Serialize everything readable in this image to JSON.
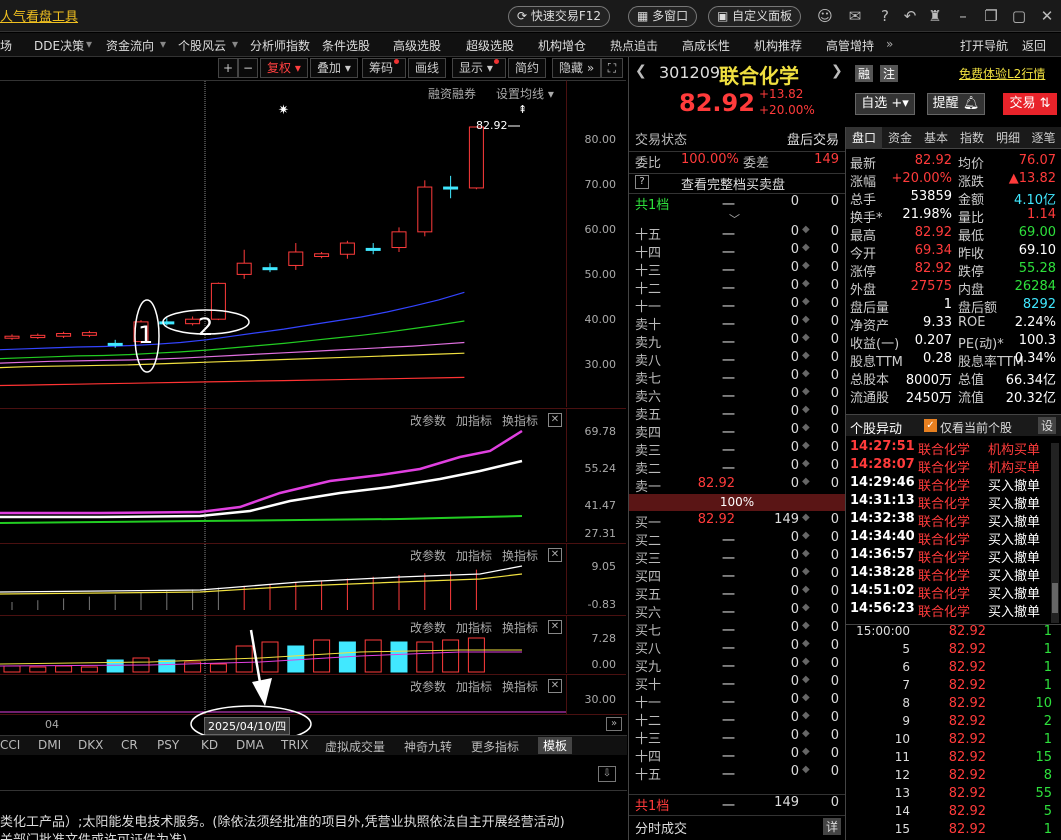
{
  "titlebar": {
    "app_title": "人气看盘工具",
    "quick_trade": "快速交易F12",
    "multi_window": "多窗口",
    "custom_panel": "自定义面板"
  },
  "menu": [
    "场",
    "DDE决策",
    "资金流向",
    "个股风云",
    "分析师指数",
    "条件选股",
    "高级选股",
    "超级选股",
    "机构增仓",
    "热点追击",
    "高成长性",
    "机构推荐",
    "高管增持",
    "打开导航",
    "返回"
  ],
  "chart_toolbar": {
    "fuquan": "复权",
    "overlay": "叠加",
    "chips": "筹码",
    "draw": "画线",
    "display": "显示",
    "simple": "简约",
    "hide": "隐藏"
  },
  "main_panel": {
    "margin_label": "融资融券",
    "ma_settings": "设置均线",
    "last_price_tag": "82.92",
    "y_ticks": [
      "80.00",
      "70.00",
      "60.00",
      "50.00",
      "40.00",
      "30.00"
    ],
    "annotation_1": "1",
    "annotation_2": "2"
  },
  "sub_panels": [
    {
      "btns": [
        "改参数",
        "加指标",
        "换指标"
      ],
      "ticks": [
        "69.78",
        "55.24",
        "41.47",
        "27.31"
      ]
    },
    {
      "btns": [
        "改参数",
        "加指标",
        "换指标"
      ],
      "ticks": [
        "9.05",
        "-0.83"
      ]
    },
    {
      "btns": [
        "改参数",
        "加指标",
        "换指标"
      ],
      "ticks": [
        "7.28",
        "0.00"
      ]
    },
    {
      "btns": [
        "改参数",
        "加指标",
        "换指标"
      ],
      "ticks": [
        "30.00"
      ]
    }
  ],
  "date_axis": {
    "month_label": "04",
    "cursor_date": "2025/04/10/四"
  },
  "indicator_tabs": [
    "CCI",
    "DMI",
    "DKX",
    "CR",
    "PSY",
    "KD",
    "DMA",
    "TRIX",
    "虚拟成交量",
    "神奇九转",
    "更多指标",
    "模板"
  ],
  "info_text": {
    "line1": "类化工产品）;太阳能发电技术服务。(除依法须经批准的项目外,凭营业执照依法自主开展经营活动)",
    "line2": "关部门批准文件或许可证件为准)"
  },
  "stock": {
    "code": "301209",
    "name": "联合化学",
    "price": "82.92",
    "change": "+13.82",
    "change_pct": "+20.00%",
    "rong": "融",
    "zhu": "注",
    "l2_link": "免费体验L2行情",
    "watch_btn": "自选",
    "alert_btn": "提醒",
    "trade_btn": "交易"
  },
  "orderbook": {
    "status_label": "交易状态",
    "status_value": "盘后交易",
    "ratio_label": "委比",
    "ratio_value": "100.00%",
    "diff_label": "委差",
    "diff_value": "149",
    "full_book": "查看完整档买卖盘",
    "total_top": {
      "label": "共1档",
      "price": "一",
      "vol": "0",
      "w": "0"
    },
    "asks": [
      {
        "label": "十五",
        "price": "一",
        "vol": "0",
        "w": "0"
      },
      {
        "label": "十四",
        "price": "一",
        "vol": "0",
        "w": "0"
      },
      {
        "label": "十三",
        "price": "一",
        "vol": "0",
        "w": "0"
      },
      {
        "label": "十二",
        "price": "一",
        "vol": "0",
        "w": "0"
      },
      {
        "label": "十一",
        "price": "一",
        "vol": "0",
        "w": "0"
      },
      {
        "label": "卖十",
        "price": "一",
        "vol": "0",
        "w": "0"
      },
      {
        "label": "卖九",
        "price": "一",
        "vol": "0",
        "w": "0"
      },
      {
        "label": "卖八",
        "price": "一",
        "vol": "0",
        "w": "0"
      },
      {
        "label": "卖七",
        "price": "一",
        "vol": "0",
        "w": "0"
      },
      {
        "label": "卖六",
        "price": "一",
        "vol": "0",
        "w": "0"
      },
      {
        "label": "卖五",
        "price": "一",
        "vol": "0",
        "w": "0"
      },
      {
        "label": "卖四",
        "price": "一",
        "vol": "0",
        "w": "0"
      },
      {
        "label": "卖三",
        "price": "一",
        "vol": "0",
        "w": "0"
      },
      {
        "label": "卖二",
        "price": "一",
        "vol": "0",
        "w": "0"
      },
      {
        "label": "卖一",
        "price": "82.92",
        "vol": "0",
        "w": "0"
      }
    ],
    "mid_pct": "100%",
    "bids": [
      {
        "label": "买一",
        "price": "82.92",
        "vol": "149",
        "w": "0"
      },
      {
        "label": "买二",
        "price": "一",
        "vol": "0",
        "w": "0"
      },
      {
        "label": "买三",
        "price": "一",
        "vol": "0",
        "w": "0"
      },
      {
        "label": "买四",
        "price": "一",
        "vol": "0",
        "w": "0"
      },
      {
        "label": "买五",
        "price": "一",
        "vol": "0",
        "w": "0"
      },
      {
        "label": "买六",
        "price": "一",
        "vol": "0",
        "w": "0"
      },
      {
        "label": "买七",
        "price": "一",
        "vol": "0",
        "w": "0"
      },
      {
        "label": "买八",
        "price": "一",
        "vol": "0",
        "w": "0"
      },
      {
        "label": "买九",
        "price": "一",
        "vol": "0",
        "w": "0"
      },
      {
        "label": "买十",
        "price": "一",
        "vol": "0",
        "w": "0"
      },
      {
        "label": "十一",
        "price": "一",
        "vol": "0",
        "w": "0"
      },
      {
        "label": "十二",
        "price": "一",
        "vol": "0",
        "w": "0"
      },
      {
        "label": "十三",
        "price": "一",
        "vol": "0",
        "w": "0"
      },
      {
        "label": "十四",
        "price": "一",
        "vol": "0",
        "w": "0"
      },
      {
        "label": "十五",
        "price": "一",
        "vol": "0",
        "w": "0"
      }
    ],
    "total_bottom": {
      "label": "共1档",
      "price": "一",
      "vol": "149",
      "w": "0"
    },
    "tick_title": "分时成交",
    "tick_btn": "详"
  },
  "quote": {
    "tabs": [
      "盘口",
      "资金",
      "基本",
      "指数",
      "明细",
      "逐笔"
    ],
    "rows": [
      {
        "l1": "最新",
        "v1": "82.92",
        "c1": "red",
        "l2": "均价",
        "v2": "76.07",
        "c2": "red"
      },
      {
        "l1": "涨幅",
        "v1": "+20.00%",
        "c1": "red",
        "l2": "涨跌",
        "v2": "▲13.82",
        "c2": "red"
      },
      {
        "l1": "总手",
        "v1": "53859",
        "c1": "white",
        "l2": "金额",
        "v2": "4.10亿",
        "c2": "cyan"
      },
      {
        "l1": "换手*",
        "v1": "21.98%",
        "c1": "white",
        "l2": "量比",
        "v2": "1.14",
        "c2": "red"
      },
      {
        "l1": "最高",
        "v1": "82.92",
        "c1": "red",
        "l2": "最低",
        "v2": "69.00",
        "c2": "green"
      },
      {
        "l1": "今开",
        "v1": "69.34",
        "c1": "red",
        "l2": "昨收",
        "v2": "69.10",
        "c2": "white"
      },
      {
        "l1": "涨停",
        "v1": "82.92",
        "c1": "red",
        "l2": "跌停",
        "v2": "55.28",
        "c2": "green"
      },
      {
        "l1": "外盘",
        "v1": "27575",
        "c1": "red",
        "l2": "内盘",
        "v2": "26284",
        "c2": "green"
      },
      {
        "l1": "盘后量",
        "v1": "1",
        "c1": "white",
        "l2": "盘后额",
        "v2": "8292",
        "c2": "cyan"
      },
      {
        "l1": "净资产",
        "v1": "9.33",
        "c1": "white",
        "l2": "ROE",
        "v2": "2.24%",
        "c2": "white"
      },
      {
        "l1": "收益(一)",
        "v1": "0.207",
        "c1": "white",
        "l2": "PE(动)*",
        "v2": "100.3",
        "c2": "white"
      },
      {
        "l1": "股息TTM",
        "v1": "0.28",
        "c1": "white",
        "l2": "股息率TTM",
        "v2": "0.34%",
        "c2": "white"
      },
      {
        "l1": "总股本",
        "v1": "8000万",
        "c1": "white",
        "l2": "总值",
        "v2": "66.34亿",
        "c2": "white"
      },
      {
        "l1": "流通股",
        "v1": "2450万",
        "c1": "white",
        "l2": "流值",
        "v2": "20.32亿",
        "c2": "white"
      }
    ],
    "movement_title": "个股异动",
    "movement_check": "仅看当前个股",
    "movement_set": "设",
    "movements": [
      {
        "t": "14:27:51",
        "s": "联合化学",
        "a": "机构买单",
        "c": "red"
      },
      {
        "t": "14:28:07",
        "s": "联合化学",
        "a": "机构买单",
        "c": "red"
      },
      {
        "t": "14:29:46",
        "s": "联合化学",
        "a": "买入撤单",
        "c": "white"
      },
      {
        "t": "14:31:13",
        "s": "联合化学",
        "a": "买入撤单",
        "c": "white"
      },
      {
        "t": "14:32:38",
        "s": "联合化学",
        "a": "买入撤单",
        "c": "white"
      },
      {
        "t": "14:34:40",
        "s": "联合化学",
        "a": "买入撤单",
        "c": "white"
      },
      {
        "t": "14:36:57",
        "s": "联合化学",
        "a": "买入撤单",
        "c": "white"
      },
      {
        "t": "14:38:28",
        "s": "联合化学",
        "a": "买入撤单",
        "c": "white"
      },
      {
        "t": "14:51:02",
        "s": "联合化学",
        "a": "买入撤单",
        "c": "white"
      },
      {
        "t": "14:56:23",
        "s": "联合化学",
        "a": "买入撤单",
        "c": "white"
      }
    ],
    "ticks": [
      {
        "t": "15:00:00",
        "p": "82.92",
        "v": "1"
      },
      {
        "t": "5",
        "p": "82.92",
        "v": "1"
      },
      {
        "t": "6",
        "p": "82.92",
        "v": "1"
      },
      {
        "t": "7",
        "p": "82.92",
        "v": "1"
      },
      {
        "t": "8",
        "p": "82.92",
        "v": "10"
      },
      {
        "t": "9",
        "p": "82.92",
        "v": "2"
      },
      {
        "t": "10",
        "p": "82.92",
        "v": "1"
      },
      {
        "t": "11",
        "p": "82.92",
        "v": "15"
      },
      {
        "t": "12",
        "p": "82.92",
        "v": "8"
      },
      {
        "t": "13",
        "p": "82.92",
        "v": "55"
      },
      {
        "t": "14",
        "p": "82.92",
        "v": "5"
      },
      {
        "t": "15",
        "p": "82.92",
        "v": "1"
      }
    ]
  },
  "chart_data": {
    "type": "candlestick",
    "ylim": [
      20,
      90
    ],
    "candles": [
      {
        "o": 35.8,
        "c": 36.2,
        "h": 36.6,
        "l": 35.4
      },
      {
        "o": 35.9,
        "c": 36.4,
        "h": 36.8,
        "l": 35.6
      },
      {
        "o": 36.2,
        "c": 36.8,
        "h": 37.2,
        "l": 35.8
      },
      {
        "o": 36.4,
        "c": 37.0,
        "h": 37.4,
        "l": 36.0
      },
      {
        "o": 34.6,
        "c": 34.6,
        "h": 35.4,
        "l": 33.6
      },
      {
        "o": 35.0,
        "c": 39.4,
        "h": 39.8,
        "l": 34.6
      },
      {
        "o": 39.4,
        "c": 39.4,
        "h": 40.2,
        "l": 38.6
      },
      {
        "o": 39.0,
        "c": 40.0,
        "h": 40.6,
        "l": 38.6
      },
      {
        "o": 40.0,
        "c": 48.0,
        "h": 48.2,
        "l": 39.8
      },
      {
        "o": 50.0,
        "c": 52.5,
        "h": 55.5,
        "l": 49.0
      },
      {
        "o": 51.5,
        "c": 51.5,
        "h": 52.5,
        "l": 50.5
      },
      {
        "o": 52.0,
        "c": 55.0,
        "h": 57.0,
        "l": 51.0
      },
      {
        "o": 54.0,
        "c": 54.6,
        "h": 55.0,
        "l": 53.6
      },
      {
        "o": 54.5,
        "c": 57.0,
        "h": 57.5,
        "l": 53.5
      },
      {
        "o": 55.8,
        "c": 55.8,
        "h": 57.0,
        "l": 54.5
      },
      {
        "o": 56.0,
        "c": 59.5,
        "h": 60.5,
        "l": 55.0
      },
      {
        "o": 59.5,
        "c": 69.5,
        "h": 71.0,
        "l": 58.5
      },
      {
        "o": 69.5,
        "c": 69.5,
        "h": 72.0,
        "l": 67.0
      },
      {
        "o": 69.3,
        "c": 82.9,
        "h": 82.9,
        "l": 69.0
      }
    ],
    "ma_blue": [
      33.2,
      33.4,
      33.6,
      33.8,
      33.9,
      34.1,
      34.4,
      34.8,
      35.4,
      36.2,
      37.0,
      37.8,
      38.7,
      39.6,
      40.5,
      41.6,
      42.9,
      44.3,
      46.0
    ],
    "ma_green": [
      31.2,
      31.4,
      31.6,
      31.8,
      31.9,
      32.1,
      32.4,
      32.7,
      33.1,
      33.6,
      34.1,
      34.6,
      35.2,
      35.8,
      36.4,
      37.1,
      37.9,
      38.7,
      39.6
    ],
    "ma_pink": [
      30.2,
      30.4,
      30.6,
      30.7,
      30.8,
      30.9,
      31.1,
      31.3,
      31.6,
      31.9,
      32.2,
      32.5,
      32.8,
      33.1,
      33.4,
      33.7,
      34.0,
      34.4,
      34.8
    ],
    "ma_yellow": [
      29.2,
      29.4,
      29.5,
      29.6,
      29.7,
      29.8,
      30.0,
      30.2,
      30.4,
      30.6,
      30.8,
      31.0,
      31.2,
      31.4,
      31.6,
      31.8,
      32.0,
      32.2,
      32.4
    ],
    "ma_red": [
      25.2,
      25.3,
      25.4,
      25.5,
      25.6,
      25.7,
      25.8,
      25.9,
      26.0,
      26.1,
      26.2,
      26.3,
      26.4,
      26.5,
      26.6,
      26.7,
      26.8,
      26.9,
      27.0
    ]
  }
}
